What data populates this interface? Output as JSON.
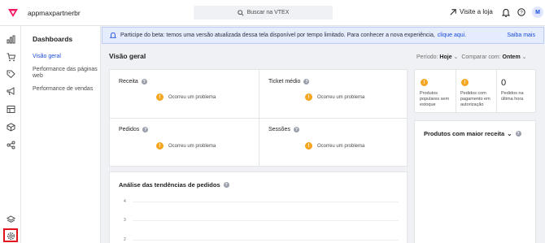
{
  "topbar": {
    "account": "appmaxpartnerbr",
    "search_placeholder": "Buscar na VTEX",
    "visit_store": "Visite a loja",
    "avatar_initial": "M",
    "brand_color": "#f71963"
  },
  "sidebar": {
    "icons": [
      "analytics-icon",
      "cart-icon",
      "tag-icon",
      "megaphone-icon",
      "catalog-icon",
      "box-icon",
      "share-icon",
      "layers-icon",
      "settings-icon"
    ]
  },
  "subnav": {
    "title": "Dashboards",
    "items": [
      {
        "label": "Visão geral",
        "active": true
      },
      {
        "label": "Performance das páginas web",
        "active": false
      },
      {
        "label": "Performance de vendas",
        "active": false
      }
    ]
  },
  "banner": {
    "text": "Participe do beta: temos uma versão atualizada dessa tela disponível por tempo limitado. Para conhecer a nova experiência,",
    "link": "clique aqui.",
    "more": "Saiba mais"
  },
  "overview": {
    "title": "Visão geral",
    "period_label": "Período:",
    "period_value": "Hoje",
    "compare_label": "Comparar com:",
    "compare_value": "Ontem"
  },
  "metrics": [
    {
      "label": "Receita",
      "error": "Ocorreu um problema"
    },
    {
      "label": "Ticket médio",
      "error": "Ocorreu um problema"
    },
    {
      "label": "Pedidos",
      "error": "Ocorreu um problema"
    },
    {
      "label": "Sessões",
      "error": "Ocorreu um problema"
    }
  ],
  "kpis": [
    {
      "label": "Produtos populares sem estoque"
    },
    {
      "label": "Pedidos com pagamento em autorização"
    },
    {
      "value": "0",
      "label": "Pedidos na última hora"
    }
  ],
  "trends": {
    "title": "Análise das tendências de pedidos",
    "yticks": [
      "4",
      "3",
      "2"
    ]
  },
  "top_products": {
    "title": "Produtos com maior receita"
  }
}
